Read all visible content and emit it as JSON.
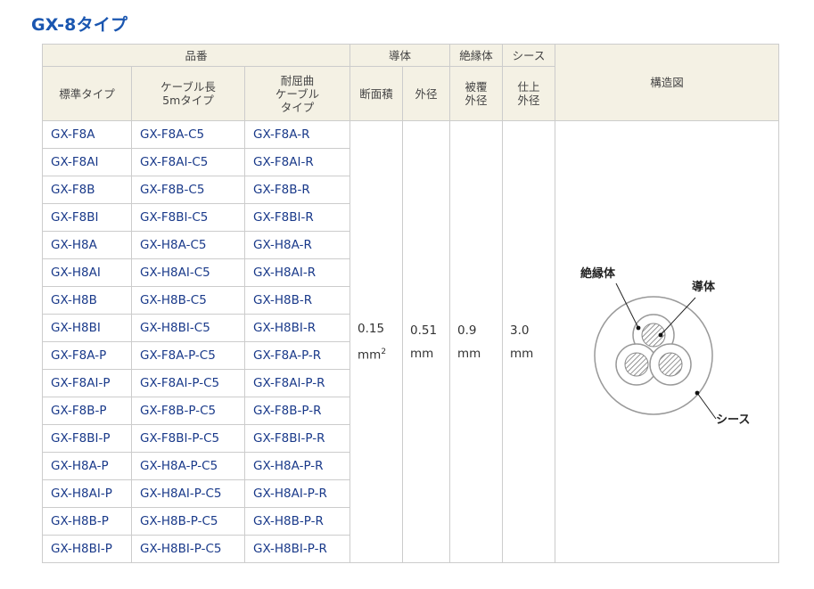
{
  "title": "GX-8タイプ",
  "header": {
    "hinban": "品番",
    "conductor": "導体",
    "insulator": "絶縁体",
    "sheath": "シース",
    "structure": "構造図",
    "std_type": "標準タイプ",
    "cable5m_1": "ケーブル長",
    "cable5m_2": "5mタイプ",
    "flex_1": "耐屈曲",
    "flex_2": "ケーブル",
    "flex_3": "タイプ",
    "area": "断面積",
    "outer": "外径",
    "cover_1": "被覆",
    "cover_2": "外径",
    "finish_1": "仕上",
    "finish_2": "外径"
  },
  "rows": [
    [
      "GX-F8A",
      "GX-F8A-C5",
      "GX-F8A-R"
    ],
    [
      "GX-F8AI",
      "GX-F8AI-C5",
      "GX-F8AI-R"
    ],
    [
      "GX-F8B",
      "GX-F8B-C5",
      "GX-F8B-R"
    ],
    [
      "GX-F8BI",
      "GX-F8BI-C5",
      "GX-F8BI-R"
    ],
    [
      "GX-H8A",
      "GX-H8A-C5",
      "GX-H8A-R"
    ],
    [
      "GX-H8AI",
      "GX-H8AI-C5",
      "GX-H8AI-R"
    ],
    [
      "GX-H8B",
      "GX-H8B-C5",
      "GX-H8B-R"
    ],
    [
      "GX-H8BI",
      "GX-H8BI-C5",
      "GX-H8BI-R"
    ],
    [
      "GX-F8A-P",
      "GX-F8A-P-C5",
      "GX-F8A-P-R"
    ],
    [
      "GX-F8AI-P",
      "GX-F8AI-P-C5",
      "GX-F8AI-P-R"
    ],
    [
      "GX-F8B-P",
      "GX-F8B-P-C5",
      "GX-F8B-P-R"
    ],
    [
      "GX-F8BI-P",
      "GX-F8BI-P-C5",
      "GX-F8BI-P-R"
    ],
    [
      "GX-H8A-P",
      "GX-H8A-P-C5",
      "GX-H8A-P-R"
    ],
    [
      "GX-H8AI-P",
      "GX-H8AI-P-C5",
      "GX-H8AI-P-R"
    ],
    [
      "GX-H8B-P",
      "GX-H8B-P-C5",
      "GX-H8B-P-R"
    ],
    [
      "GX-H8BI-P",
      "GX-H8BI-P-C5",
      "GX-H8BI-P-R"
    ]
  ],
  "values": {
    "area_num": "0.15",
    "area_unit": "mm",
    "area_exp": "2",
    "outer_num": "0.51",
    "outer_unit": "mm",
    "cover_num": "0.9",
    "cover_unit": "mm",
    "finish_num": "3.0",
    "finish_unit": "mm"
  },
  "diagram": {
    "label_insulator": "絶縁体",
    "label_conductor": "導体",
    "label_sheath": "シース"
  },
  "colors": {
    "title": "#1a56b0",
    "link_text": "#1a3a8a",
    "header_bg": "#f4f1e4",
    "border": "#cccccc"
  }
}
